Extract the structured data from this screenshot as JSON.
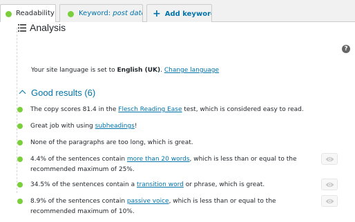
{
  "tabs": {
    "readability": "Readability",
    "keyword_label": "Keyword: ",
    "keyword_value": "post date",
    "add_keyword": "Add keyword"
  },
  "analysis": {
    "title": "Analysis",
    "help": "?",
    "language_prefix": "Your site language is set to ",
    "language": "English (UK)",
    "language_suffix": ". ",
    "change_language": "Change language"
  },
  "good_results": {
    "title": "Good results (6)",
    "items": [
      {
        "pre": "The copy scores 81.4 in the ",
        "link": "Flesch Reading Ease",
        "post": " test, which is considered easy to read."
      },
      {
        "pre": "Great job with using ",
        "link": "subheadings",
        "post": "!"
      },
      {
        "pre": "None of the paragraphs are too long, which is great.",
        "link": "",
        "post": ""
      },
      {
        "pre": "4.4% of the sentences contain ",
        "link": "more than 20 words",
        "post": ", which is less than or equal to the recommended maximum of 25%."
      },
      {
        "pre": "34.5% of the sentences contain a ",
        "link": "transition word",
        "post": " or phrase, which is great."
      },
      {
        "pre": "8.9% of the sentences contain ",
        "link": "passive voice",
        "post": ", which is less than or equal to the recommended maximum of 10%."
      }
    ]
  },
  "colors": {
    "good": "#7ad03a",
    "link": "#0073aa"
  }
}
